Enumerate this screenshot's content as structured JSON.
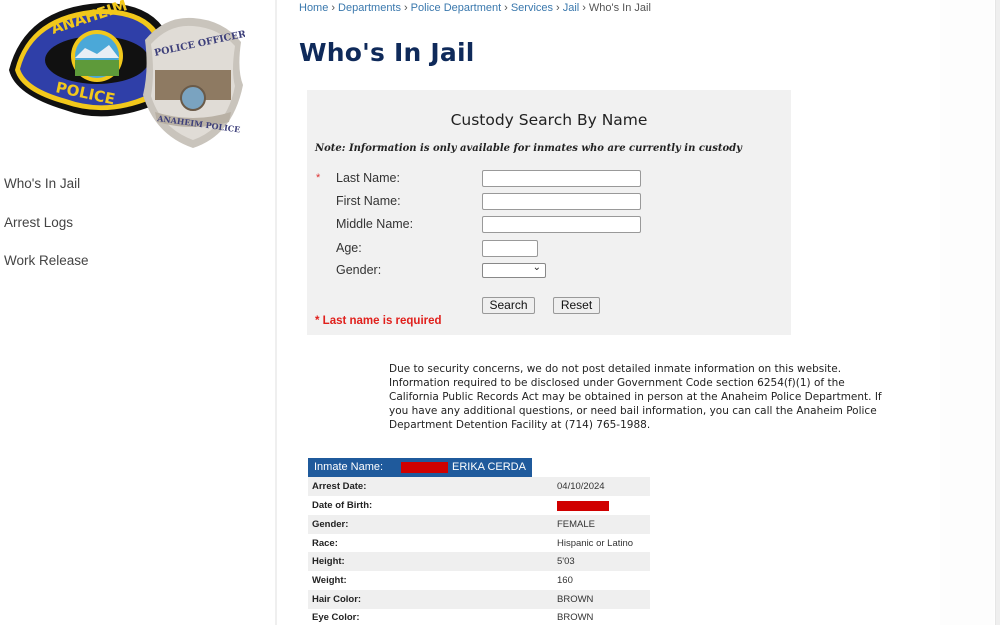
{
  "sidebar": {
    "logo": {
      "patch_text_top": "ANAHEIM",
      "patch_text_bottom": "POLICE",
      "badge_text_top": "POLICE OFFICER",
      "badge_text_bottom": "ANAHEIM POLICE"
    },
    "items": [
      {
        "label": "Who's In Jail"
      },
      {
        "label": "Arrest Logs"
      },
      {
        "label": "Work Release"
      }
    ]
  },
  "breadcrumb": {
    "items": [
      "Home",
      "Departments",
      "Police Department",
      "Services",
      "Jail"
    ],
    "current": "Who's In Jail",
    "separator": "›"
  },
  "page": {
    "title": "Who's In Jail"
  },
  "search": {
    "title": "Custody Search By Name",
    "note": "Note: Information is only available for inmates who are currently in custody",
    "required_marker": "*",
    "fields": {
      "last_name": {
        "label": "Last Name:",
        "value": ""
      },
      "first_name": {
        "label": "First Name:",
        "value": ""
      },
      "middle_name": {
        "label": "Middle Name:",
        "value": ""
      },
      "age": {
        "label": "Age:",
        "value": ""
      },
      "gender": {
        "label": "Gender:",
        "value": ""
      }
    },
    "search_label": "Search",
    "reset_label": "Reset",
    "required_message": "* Last name is required"
  },
  "disclaimer": "Due to security concerns, we do not post detailed inmate information on this website. Information required to be disclosed under Government Code section 6254(f)(1) of the California Public Records Act may be obtained in person at the Anaheim Police Department. If you have any additional questions, or need bail information, you can call the Anaheim Police Department Detention Facility at (714) 765-1988.",
  "inmate": {
    "header_label": "Inmate Name:",
    "name": "ERIKA CERDA",
    "details": [
      {
        "label": "Arrest Date:",
        "value": "04/10/2024"
      },
      {
        "label": "Date of Birth:",
        "value": "",
        "redacted": true
      },
      {
        "label": "Gender:",
        "value": "FEMALE"
      },
      {
        "label": "Race:",
        "value": "Hispanic or Latino"
      },
      {
        "label": "Height:",
        "value": "5'03"
      },
      {
        "label": "Weight:",
        "value": "160"
      },
      {
        "label": "Hair Color:",
        "value": "BROWN"
      },
      {
        "label": "Eye Color:",
        "value": "BROWN"
      }
    ]
  },
  "colors": {
    "title": "#0f2a5a",
    "link": "#3a78ad",
    "header_bar": "#1f5a9c",
    "error": "#e0201c",
    "redaction": "#d00000"
  }
}
